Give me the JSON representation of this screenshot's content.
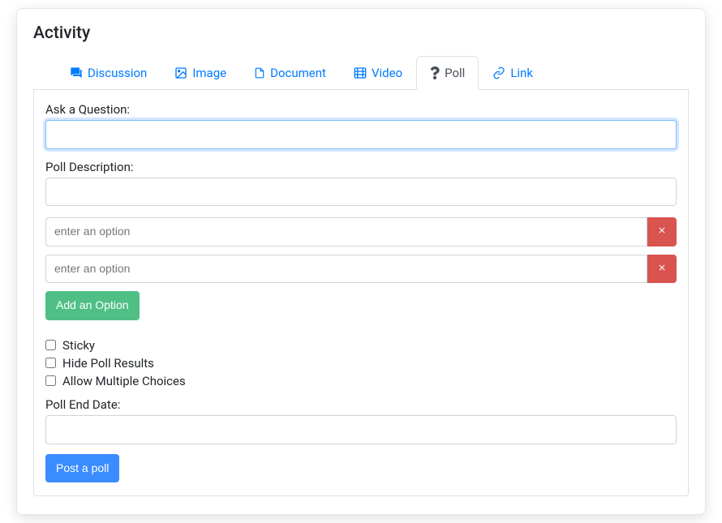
{
  "card": {
    "title": "Activity"
  },
  "tabs": {
    "discussion": "Discussion",
    "image": "Image",
    "document": "Document",
    "video": "Video",
    "poll": "Poll",
    "link": "Link"
  },
  "poll": {
    "question_label": "Ask a Question:",
    "question_value": "",
    "description_label": "Poll Description:",
    "description_value": "",
    "option_placeholder": "enter an option",
    "options": [
      {
        "value": ""
      },
      {
        "value": ""
      }
    ],
    "add_option_label": "Add an Option",
    "checkboxes": {
      "sticky": {
        "label": "Sticky",
        "checked": false
      },
      "hide_results": {
        "label": "Hide Poll Results",
        "checked": false
      },
      "allow_multiple": {
        "label": "Allow Multiple Choices",
        "checked": false
      }
    },
    "end_date_label": "Poll End Date:",
    "end_date_value": "",
    "submit_label": "Post a poll"
  },
  "colors": {
    "link": "#007bff",
    "danger": "#d9534f",
    "success": "#4fbf86",
    "primary": "#3b8cff"
  }
}
